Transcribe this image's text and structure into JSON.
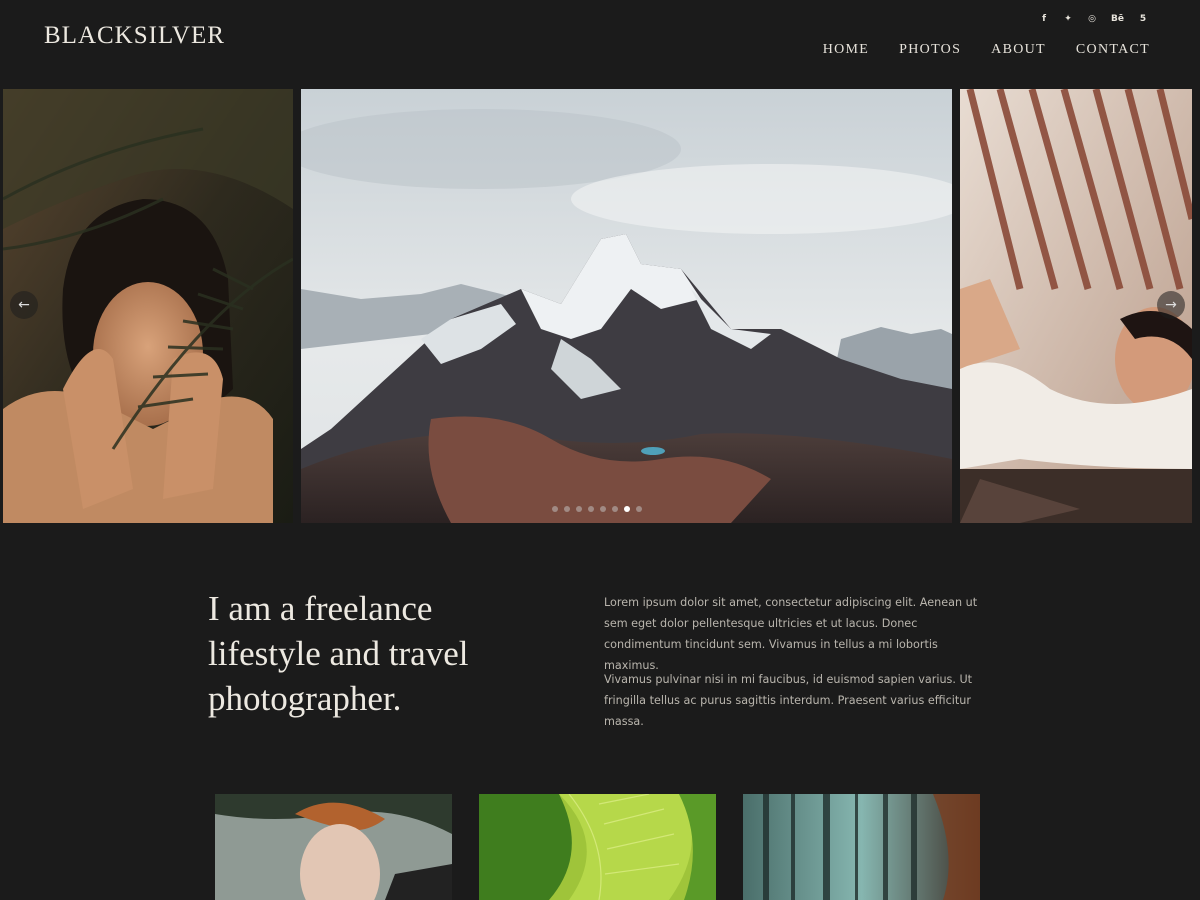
{
  "brand": {
    "logo": "BLACKSILVER"
  },
  "social": [
    {
      "icon": "facebook-icon",
      "glyph": "f"
    },
    {
      "icon": "twitter-icon",
      "glyph": "✦"
    },
    {
      "icon": "instagram-icon",
      "glyph": "◎"
    },
    {
      "icon": "behance-icon",
      "glyph": "Bē"
    },
    {
      "icon": "500px-icon",
      "glyph": "5"
    }
  ],
  "nav": {
    "items": [
      "HOME",
      "PHOTOS",
      "ABOUT",
      "CONTACT"
    ]
  },
  "slider": {
    "prev_glyph": "←",
    "next_glyph": "→",
    "dot_count": 8,
    "active_dot": 6
  },
  "intro": {
    "headline": "I am a freelance lifestyle and travel photographer.",
    "paragraph_1": "Lorem ipsum dolor sit amet, consectetur adipiscing elit. Aenean ut sem eget dolor pellentesque ultricies et ut lacus. Donec condimentum tincidunt sem. Vivamus in tellus a mi lobortis maximus.",
    "paragraph_2": "Vivamus pulvinar nisi in mi faucibus, id euismod sapien varius. Ut fringilla tellus ac purus sagittis interdum. Praesent varius efficitur massa."
  },
  "colors": {
    "background": "#1b1b1b",
    "text": "#e8e4dc",
    "muted_text": "#b9b5ad"
  }
}
